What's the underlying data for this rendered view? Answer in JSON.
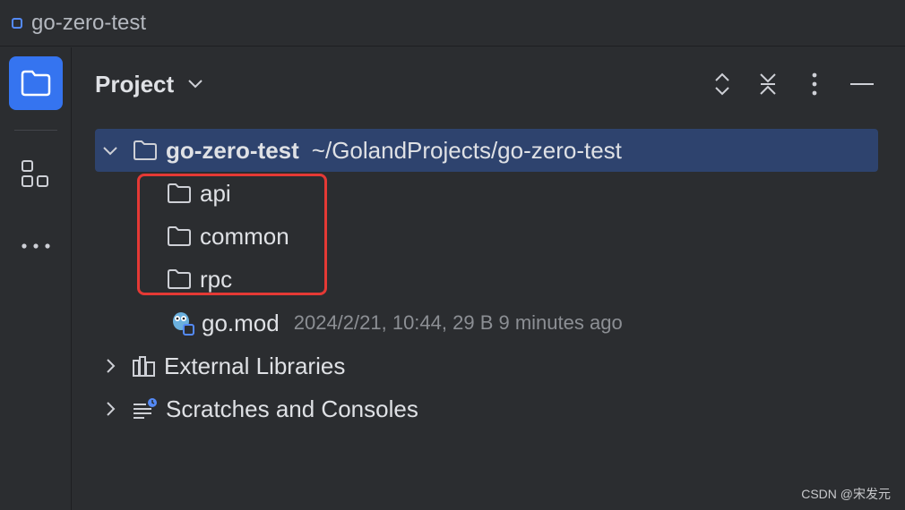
{
  "window": {
    "title": "go-zero-test"
  },
  "panel": {
    "title": "Project"
  },
  "tree": {
    "root": {
      "name": "go-zero-test",
      "path": "~/GolandProjects/go-zero-test"
    },
    "folders": [
      {
        "name": "api"
      },
      {
        "name": "common"
      },
      {
        "name": "rpc"
      }
    ],
    "file": {
      "name": "go.mod",
      "meta": "2024/2/21, 10:44, 29 B 9 minutes ago"
    },
    "external": {
      "name": "External Libraries"
    },
    "scratches": {
      "name": "Scratches and Consoles"
    }
  },
  "watermark": "CSDN @宋发元",
  "colors": {
    "accent": "#3574f0",
    "selection": "#2e436e",
    "highlight": "#e53935"
  },
  "icons": [
    "folder-icon",
    "structure-icon",
    "more-icon",
    "expand-all-icon",
    "collapse-all-icon",
    "options-icon",
    "hide-icon",
    "go-mod-icon",
    "library-icon",
    "scratches-icon"
  ]
}
